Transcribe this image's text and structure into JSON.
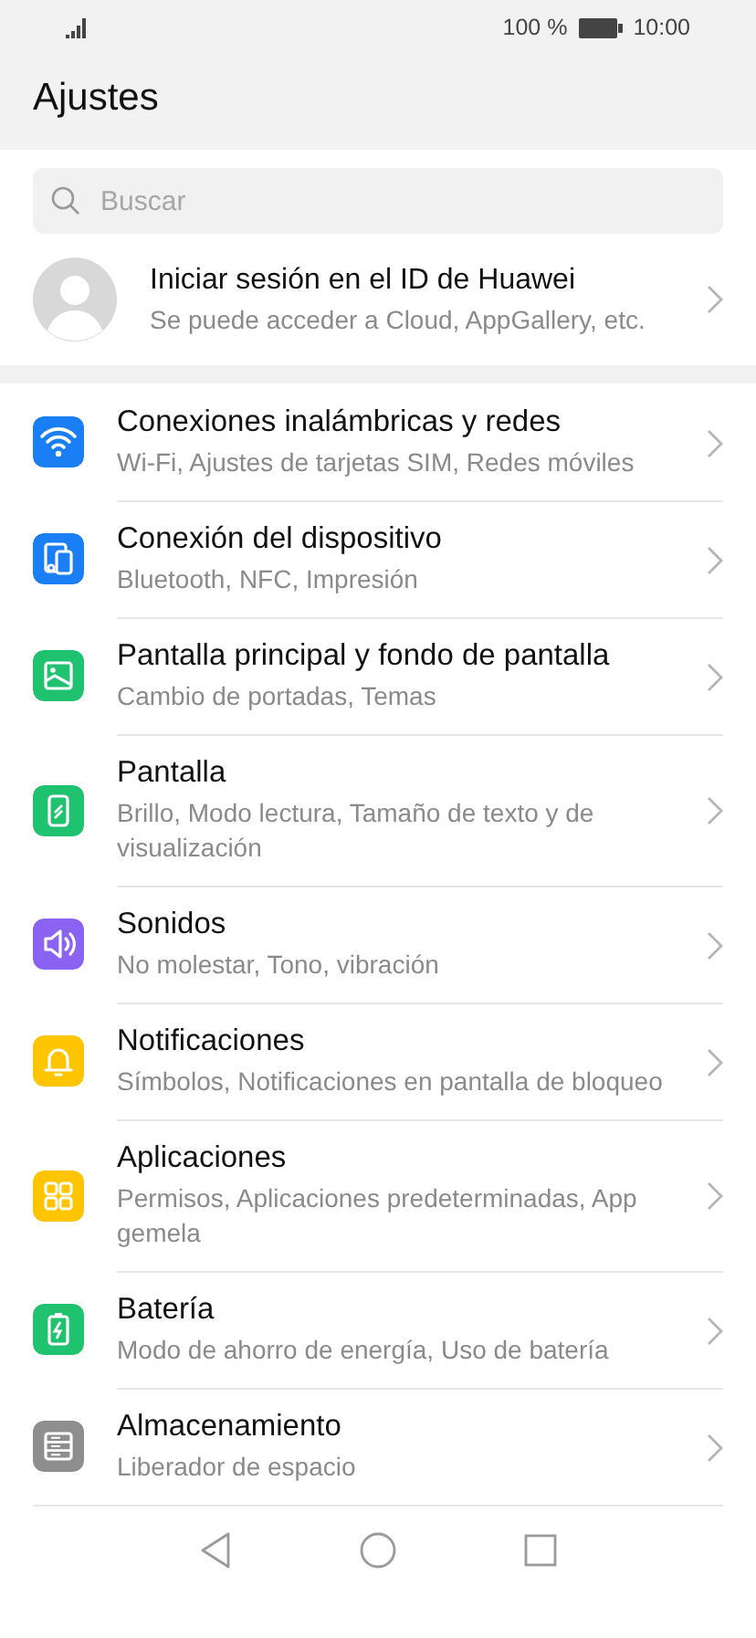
{
  "status_bar": {
    "battery_text": "100 %",
    "time": "10:00"
  },
  "title": "Ajustes",
  "search": {
    "placeholder": "Buscar"
  },
  "account": {
    "title": "Iniciar sesión en el ID de Huawei",
    "subtitle": "Se puede acceder a Cloud, AppGallery, etc."
  },
  "items": [
    {
      "kind": "wifi",
      "color": "#1a7ef5",
      "title": "Conexiones inalámbricas y redes",
      "subtitle": "Wi-Fi, Ajustes de tarjetas SIM, Redes móviles"
    },
    {
      "kind": "devices",
      "color": "#1a7ef5",
      "title": "Conexión del dispositivo",
      "subtitle": "Bluetooth, NFC, Impresión"
    },
    {
      "kind": "image",
      "color": "#1fc36f",
      "title": "Pantalla principal y fondo de pantalla",
      "subtitle": "Cambio de portadas, Temas"
    },
    {
      "kind": "display",
      "color": "#1fc36f",
      "title": "Pantalla",
      "subtitle": "Brillo, Modo lectura, Tamaño de texto y de visualización"
    },
    {
      "kind": "sound",
      "color": "#8a63f2",
      "title": "Sonidos",
      "subtitle": "No molestar, Tono, vibración"
    },
    {
      "kind": "bell",
      "color": "#fec500",
      "title": "Notificaciones",
      "subtitle": "Símbolos, Notificaciones en pantalla de bloqueo"
    },
    {
      "kind": "apps",
      "color": "#fec500",
      "title": "Aplicaciones",
      "subtitle": "Permisos, Aplicaciones predeterminadas, App gemela"
    },
    {
      "kind": "battery",
      "color": "#1fc36f",
      "title": "Batería",
      "subtitle": "Modo de ahorro de energía, Uso de batería"
    },
    {
      "kind": "storage",
      "color": "#8e8e8e",
      "title": "Almacenamiento",
      "subtitle": "Liberador de espacio"
    }
  ]
}
